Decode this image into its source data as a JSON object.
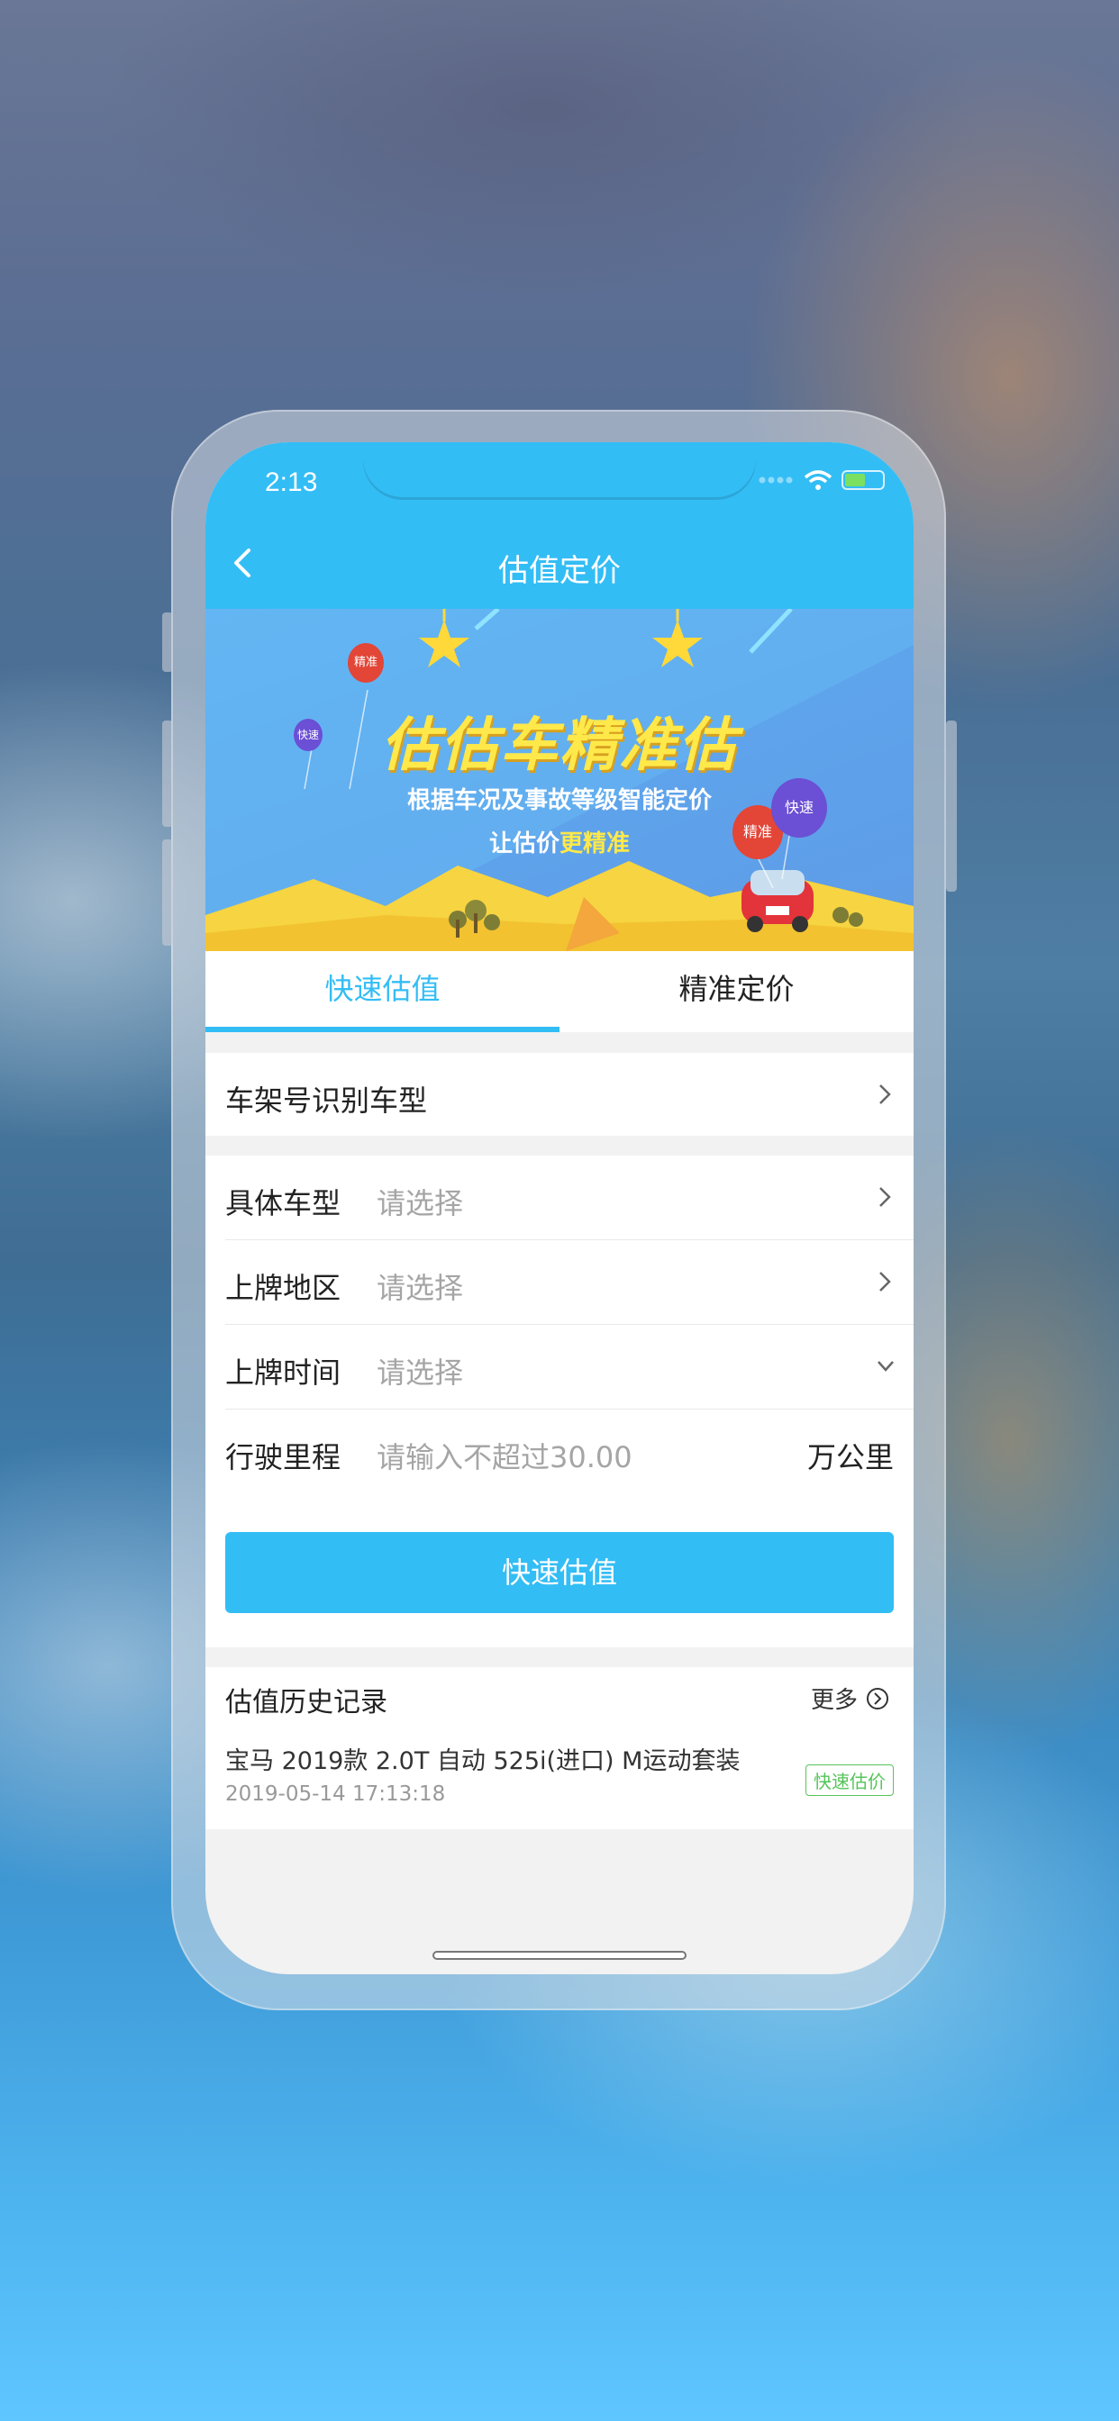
{
  "status": {
    "time": "2:13"
  },
  "nav": {
    "title": "估值定价"
  },
  "banner": {
    "title": "估估车精准估",
    "subtitle": "根据车况及事故等级智能定价",
    "tagline_prefix": "让估价",
    "tagline_highlight": "更精准",
    "balloon_precise": "精准",
    "balloon_fast": "快速"
  },
  "tabs": [
    {
      "label": "快速估值",
      "active": true
    },
    {
      "label": "精准定价",
      "active": false
    }
  ],
  "vin_row": {
    "label": "车架号识别车型"
  },
  "form": {
    "model": {
      "label": "具体车型",
      "placeholder": "请选择"
    },
    "region": {
      "label": "上牌地区",
      "placeholder": "请选择"
    },
    "date": {
      "label": "上牌时间",
      "placeholder": "请选择"
    },
    "mileage": {
      "label": "行驶里程",
      "placeholder": "请输入不超过30.00",
      "unit": "万公里"
    }
  },
  "submit_label": "快速估值",
  "history": {
    "title": "估值历史记录",
    "more": "更多",
    "items": [
      {
        "name": "宝马 2019款 2.0T 自动 525i(进口) M运动套装",
        "date": "2019-05-14 17:13:18",
        "badge": "快速估价"
      }
    ]
  },
  "colors": {
    "primary": "#33bdf5",
    "highlight": "#ffe84a",
    "badge": "#56c45a"
  }
}
